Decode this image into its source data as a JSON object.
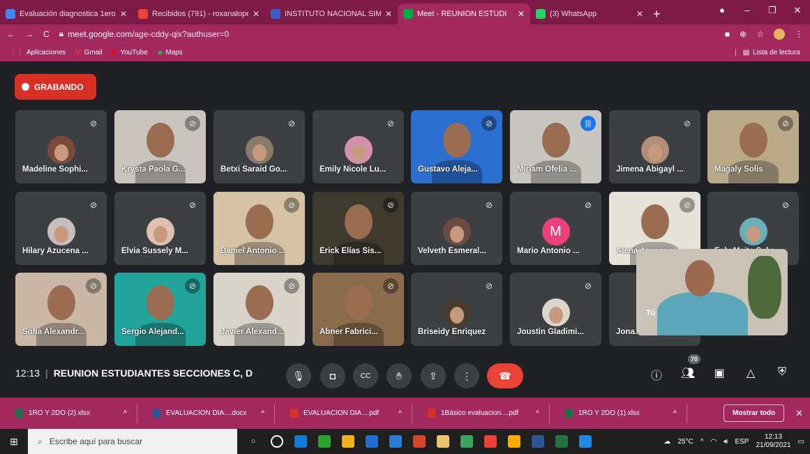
{
  "browser": {
    "tabs": [
      {
        "title": "Evaluación diagnostica 1ero. |",
        "color": "#4285f4"
      },
      {
        "title": "Recibidos (791) - roxanalope",
        "color": "#ea4335"
      },
      {
        "title": "INSTITUTO NACIONAL SIMÓ",
        "color": "#3b5cc9"
      },
      {
        "title": "Meet - REUNION ESTUDI",
        "color": "#00ac47",
        "active": true
      },
      {
        "title": "(3) WhatsApp",
        "color": "#25d366"
      }
    ],
    "url_domain": "meet.google.com",
    "url_path": "/age-cddy-qix?authuser=0",
    "bookmarks": [
      "Aplicaciones",
      "Gmail",
      "YouTube",
      "Maps"
    ],
    "reading_list": "Lista de lectura"
  },
  "meet": {
    "recording_label": "GRABANDO",
    "time": "12:13",
    "meeting_title": "REUNION ESTUDIANTES SECCIONES C, D",
    "participant_count": "70",
    "participants": [
      {
        "name": "Madeline Sophi...",
        "kind": "avatar",
        "color": "#7a4b3a"
      },
      {
        "name": "Krysta Paola G...",
        "kind": "video",
        "color": "#c9c4bd"
      },
      {
        "name": "Betxi Saraid Go...",
        "kind": "avatar",
        "color": "#8a7a6a"
      },
      {
        "name": "Emily Nicole Lu...",
        "kind": "avatar",
        "color": "#d58fb0"
      },
      {
        "name": "Gustavo Aleja...",
        "kind": "video",
        "color": "#2b6fd1"
      },
      {
        "name": "Miriam Ofelia ...",
        "kind": "video",
        "color": "#c8c6c0",
        "speaking": true
      },
      {
        "name": "Jimena Abigayl ...",
        "kind": "avatar",
        "color": "#b38c7a"
      },
      {
        "name": "Magaly Solis",
        "kind": "video",
        "color": "#b9a989"
      },
      {
        "name": "Hilary Azucena ...",
        "kind": "avatar",
        "color": "#c7bfbf"
      },
      {
        "name": "Elvia Sussely M...",
        "kind": "avatar",
        "color": "#e0c0b0"
      },
      {
        "name": "Daniel Antonio ...",
        "kind": "video",
        "color": "#d6c3a5"
      },
      {
        "name": "Erick Elías Sis...",
        "kind": "video",
        "color": "#3e3a2e"
      },
      {
        "name": "Velveth Esmeral...",
        "kind": "avatar",
        "color": "#6b4a3f"
      },
      {
        "name": "Mario Antonio ...",
        "kind": "letter",
        "letter": "M",
        "color": "#ec407a"
      },
      {
        "name": "Alena Azucena ...",
        "kind": "video",
        "color": "#e5e2d8"
      },
      {
        "name": "Esly Maite Suly...",
        "kind": "avatar",
        "color": "#6ab0b8"
      },
      {
        "name": "Sofía Alexandr...",
        "kind": "video",
        "color": "#cbb7a5"
      },
      {
        "name": "Sergio Alejand...",
        "kind": "video",
        "color": "#21a49c"
      },
      {
        "name": "Javier Alexand...",
        "kind": "video",
        "color": "#d9d4c9"
      },
      {
        "name": "Abner Fabrici...",
        "kind": "video",
        "color": "#8a6b4b"
      },
      {
        "name": "Briseidy Enriquez",
        "kind": "avatar",
        "color": "#4a3b2f"
      },
      {
        "name": "Joustin Gladimi...",
        "kind": "avatar",
        "color": "#dcd6cf"
      },
      {
        "name": "Jona...",
        "kind": "avatar",
        "color": "#7a6a5a"
      }
    ],
    "self_label": "Tú",
    "controls": [
      "mic",
      "camera",
      "captions",
      "raise-hand",
      "present",
      "more",
      "end-call"
    ]
  },
  "downloads": {
    "items": [
      {
        "name": "1RO Y 2DO (2).xlsx",
        "type": "xlsx"
      },
      {
        "name": "EVALUACION DIA....docx",
        "type": "docx"
      },
      {
        "name": "EVALUACION DIA....pdf",
        "type": "pdf"
      },
      {
        "name": "1Básico evaluacion....pdf",
        "type": "pdf"
      },
      {
        "name": "1RO Y 2DO (1).xlsx",
        "type": "xlsx"
      }
    ],
    "show_all": "Mostrar todo"
  },
  "taskbar": {
    "search_placeholder": "Escribe aquí para buscar",
    "weather": "25°C",
    "lang": "ESP",
    "time": "12:13",
    "date": "21/09/2021",
    "app_colors": [
      "#ffffff",
      "#0f7ad5",
      "#2ca12c",
      "#f2b01e",
      "#1f6fd0",
      "#2b7cd3",
      "#d24726",
      "#e9c46a",
      "#3ba55c",
      "#e94235",
      "#f9ab00",
      "#2b579a",
      "#217346",
      "#1e88e5"
    ]
  }
}
